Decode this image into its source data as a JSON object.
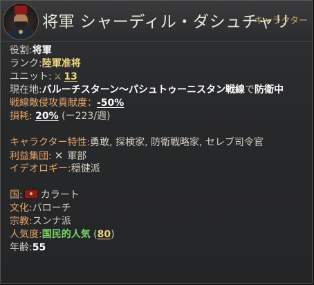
{
  "header": {
    "name": "将軍 シャーディル・ダシュチャリ",
    "type_badge": "キャラクター"
  },
  "details": {
    "role_label": "役割:",
    "role_value": "将軍",
    "rank_label": "ランク:",
    "rank_value": "陸軍准将",
    "unit_label": "ユニット:",
    "unit_icon": "crossed-swords-icon",
    "unit_value": "13",
    "location_label": "現在地:",
    "location_value": "バルーチスターン〜パシュトゥーニスタン戦線",
    "location_connector": "で",
    "location_status": "防衛中",
    "contribution_label": "戦線敵侵攻貢献度：",
    "contribution_value": "-50%",
    "attrition_label": "損耗:",
    "attrition_value": "20%",
    "attrition_open": "(",
    "attrition_change": "ー223",
    "attrition_unit": "/週)",
    "traits_label": "キャラクター特性:",
    "traits_value": "勇敢, 探検家, 防衛戦略家, セレブ司令官",
    "interest_group_label": "利益集団:",
    "interest_group_icon": "crossed-swords-icon",
    "interest_group_value": "軍部",
    "ideology_label": "イデオロギー:",
    "ideology_value": "穏健派",
    "country_label": "国:",
    "country_flag": "kalat-flag-icon",
    "country_value": "カラート",
    "culture_label": "文化:",
    "culture_value": "バローチ",
    "religion_label": "宗教:",
    "religion_value": "スンナ派",
    "popularity_label": "人気度:",
    "popularity_value": "国民的人気",
    "popularity_open": "(",
    "popularity_score": "80",
    "popularity_close": ")",
    "age_label": "年齢:",
    "age_value": "55"
  },
  "colors": {
    "label_orange": "#e8a66a",
    "value_yellow": "#f1d680",
    "value_green": "#7bd46a",
    "badge_gold": "#c9a769"
  }
}
